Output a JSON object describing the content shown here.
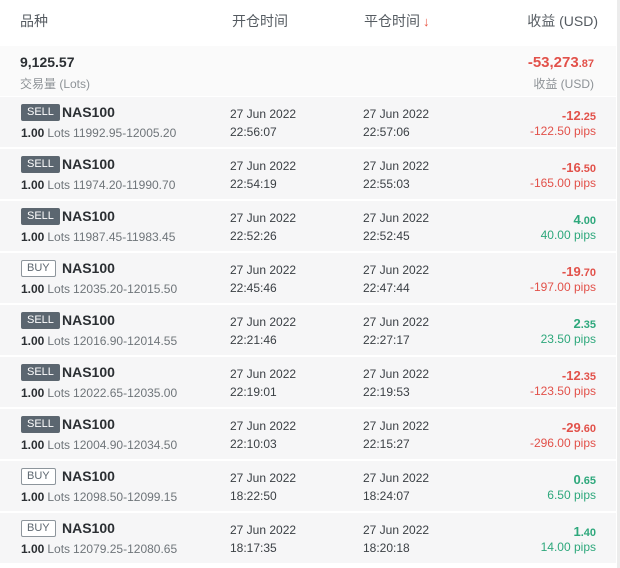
{
  "header": {
    "symbol": "品种",
    "open_time": "开仓时间",
    "close_time": "平仓时间",
    "sort_arrow": "↓",
    "profit": "收益 (USD)"
  },
  "summary": {
    "volume": "9,125.57",
    "volume_label": "交易量 (Lots)",
    "profit_main": "-53,273",
    "profit_dec": ".87",
    "profit_label": "收益 (USD)"
  },
  "lots_unit": "Lots",
  "colors": {
    "negative": "#e2514a",
    "positive": "#2ea87c",
    "sell_badge": "#5b6670"
  },
  "trades": [
    {
      "side": "SELL",
      "symbol": "NAS100",
      "lots": "1.00",
      "range": "11992.95-12005.20",
      "open_date": "27 Jun 2022",
      "open_time": "22:56:07",
      "close_date": "27 Jun 2022",
      "close_time": "22:57:06",
      "profit_main": "-12",
      "profit_dec": ".25",
      "pips": "-122.50 pips",
      "positive": false
    },
    {
      "side": "SELL",
      "symbol": "NAS100",
      "lots": "1.00",
      "range": "11974.20-11990.70",
      "open_date": "27 Jun 2022",
      "open_time": "22:54:19",
      "close_date": "27 Jun 2022",
      "close_time": "22:55:03",
      "profit_main": "-16",
      "profit_dec": ".50",
      "pips": "-165.00 pips",
      "positive": false
    },
    {
      "side": "SELL",
      "symbol": "NAS100",
      "lots": "1.00",
      "range": "11987.45-11983.45",
      "open_date": "27 Jun 2022",
      "open_time": "22:52:26",
      "close_date": "27 Jun 2022",
      "close_time": "22:52:45",
      "profit_main": "4",
      "profit_dec": ".00",
      "pips": "40.00 pips",
      "positive": true
    },
    {
      "side": "BUY",
      "symbol": "NAS100",
      "lots": "1.00",
      "range": "12035.20-12015.50",
      "open_date": "27 Jun 2022",
      "open_time": "22:45:46",
      "close_date": "27 Jun 2022",
      "close_time": "22:47:44",
      "profit_main": "-19",
      "profit_dec": ".70",
      "pips": "-197.00 pips",
      "positive": false
    },
    {
      "side": "SELL",
      "symbol": "NAS100",
      "lots": "1.00",
      "range": "12016.90-12014.55",
      "open_date": "27 Jun 2022",
      "open_time": "22:21:46",
      "close_date": "27 Jun 2022",
      "close_time": "22:27:17",
      "profit_main": "2",
      "profit_dec": ".35",
      "pips": "23.50 pips",
      "positive": true
    },
    {
      "side": "SELL",
      "symbol": "NAS100",
      "lots": "1.00",
      "range": "12022.65-12035.00",
      "open_date": "27 Jun 2022",
      "open_time": "22:19:01",
      "close_date": "27 Jun 2022",
      "close_time": "22:19:53",
      "profit_main": "-12",
      "profit_dec": ".35",
      "pips": "-123.50 pips",
      "positive": false
    },
    {
      "side": "SELL",
      "symbol": "NAS100",
      "lots": "1.00",
      "range": "12004.90-12034.50",
      "open_date": "27 Jun 2022",
      "open_time": "22:10:03",
      "close_date": "27 Jun 2022",
      "close_time": "22:15:27",
      "profit_main": "-29",
      "profit_dec": ".60",
      "pips": "-296.00 pips",
      "positive": false
    },
    {
      "side": "BUY",
      "symbol": "NAS100",
      "lots": "1.00",
      "range": "12098.50-12099.15",
      "open_date": "27 Jun 2022",
      "open_time": "18:22:50",
      "close_date": "27 Jun 2022",
      "close_time": "18:24:07",
      "profit_main": "0",
      "profit_dec": ".65",
      "pips": "6.50 pips",
      "positive": true
    },
    {
      "side": "BUY",
      "symbol": "NAS100",
      "lots": "1.00",
      "range": "12079.25-12080.65",
      "open_date": "27 Jun 2022",
      "open_time": "18:17:35",
      "close_date": "27 Jun 2022",
      "close_time": "18:20:18",
      "profit_main": "1",
      "profit_dec": ".40",
      "pips": "14.00 pips",
      "positive": true
    }
  ]
}
